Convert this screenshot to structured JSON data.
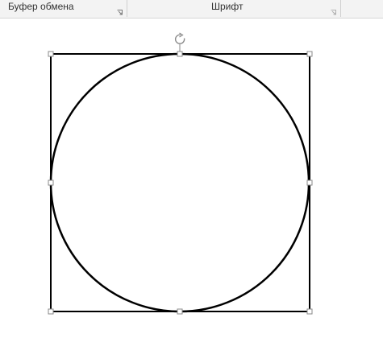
{
  "ribbon": {
    "groups": [
      {
        "label": "Буфер обмена",
        "launcher_icon": "dialog-launcher-icon"
      },
      {
        "label": "Шрифт",
        "launcher_icon": "dialog-launcher-icon"
      }
    ]
  },
  "shape": {
    "type": "circle-in-square",
    "stroke_color": "#000000",
    "handle_color": "#8a8a8a",
    "rotate_icon": "rotate-handle-icon"
  }
}
